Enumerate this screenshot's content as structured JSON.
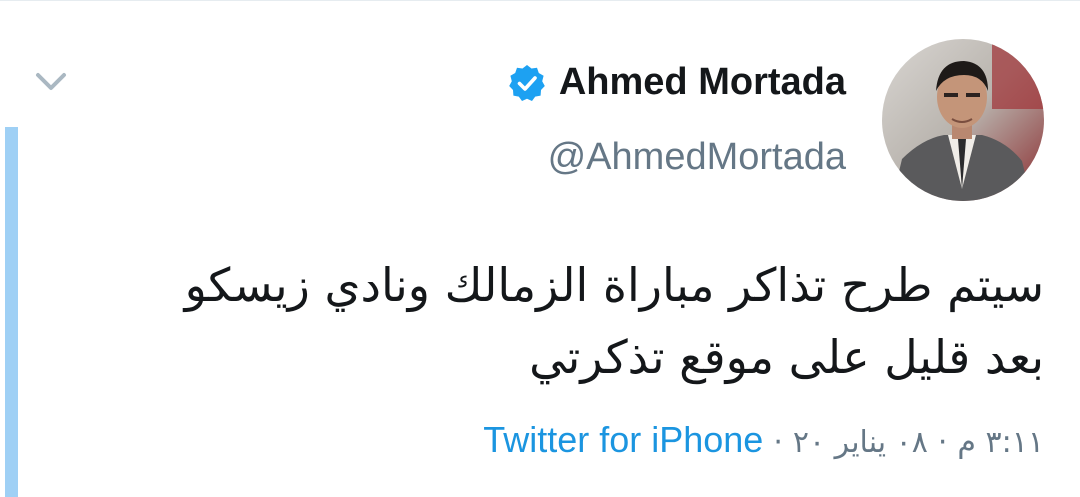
{
  "tweet": {
    "author_name": "Ahmed Mortada",
    "author_handle": "@AhmedMortada",
    "verified": true,
    "text_lines": [
      "سيتم طرح تذاكر مباراة الزمالك ونادي زيسكو",
      "بعد قليل على موقع تذكرتي"
    ],
    "time": "٣:١١ م",
    "date": "٠٨ يناير ٢٠",
    "separator": "·",
    "source": "Twitter for iPhone"
  },
  "icons": {
    "caret": "chevron-down-icon",
    "verified": "verified-badge-icon",
    "avatar": "avatar"
  },
  "colors": {
    "accent": "#1b95e0",
    "verified": "#1da1f2",
    "thread_line": "#9fd0f5",
    "text": "#14171a",
    "secondary": "#657786",
    "caret": "#aab8c2"
  }
}
